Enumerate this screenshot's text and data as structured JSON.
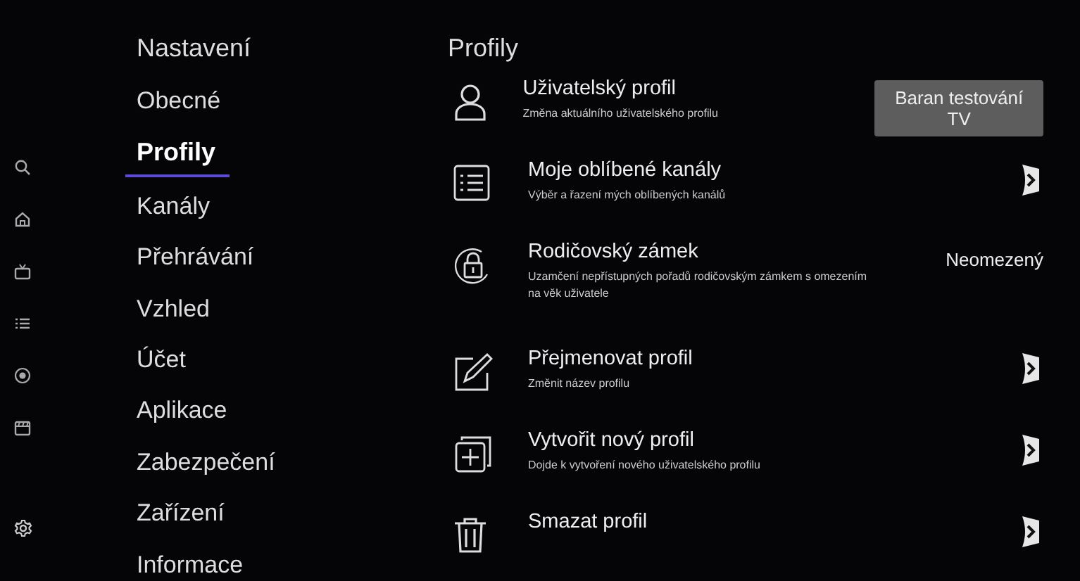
{
  "nav": {
    "title": "Nastavení",
    "items": [
      {
        "label": "Obecné",
        "selected": false
      },
      {
        "label": "Profily",
        "selected": true
      },
      {
        "label": "Kanály",
        "selected": false
      },
      {
        "label": "Přehrávání",
        "selected": false
      },
      {
        "label": "Vzhled",
        "selected": false
      },
      {
        "label": "Účet",
        "selected": false
      },
      {
        "label": "Aplikace",
        "selected": false
      },
      {
        "label": "Zabezpečení",
        "selected": false
      },
      {
        "label": "Zařízení",
        "selected": false
      },
      {
        "label": "Informace",
        "selected": false
      }
    ]
  },
  "content": {
    "title": "Profily",
    "rows": [
      {
        "kind": "button",
        "title": "Uživatelský profil",
        "subtitle": "Změna aktuálního uživatelského profilu",
        "value": "Baran testování TV"
      },
      {
        "kind": "chevron",
        "title": "Moje oblíbené kanály",
        "subtitle": "Výběr a řazení mých oblíbených kanálů"
      },
      {
        "kind": "value",
        "title": "Rodičovský zámek",
        "subtitle": "Uzamčení nepřístupných pořadů rodičovským zámkem s omezením na věk uživatele",
        "value": "Neomezený"
      },
      {
        "kind": "chevron",
        "title": "Přejmenovat profil",
        "subtitle": "Změnit název profilu"
      },
      {
        "kind": "chevron",
        "title": "Vytvořit nový profil",
        "subtitle": "Dojde k vytvoření nového uživatelského profilu"
      },
      {
        "kind": "chevron",
        "title": "Smazat profil"
      }
    ]
  }
}
